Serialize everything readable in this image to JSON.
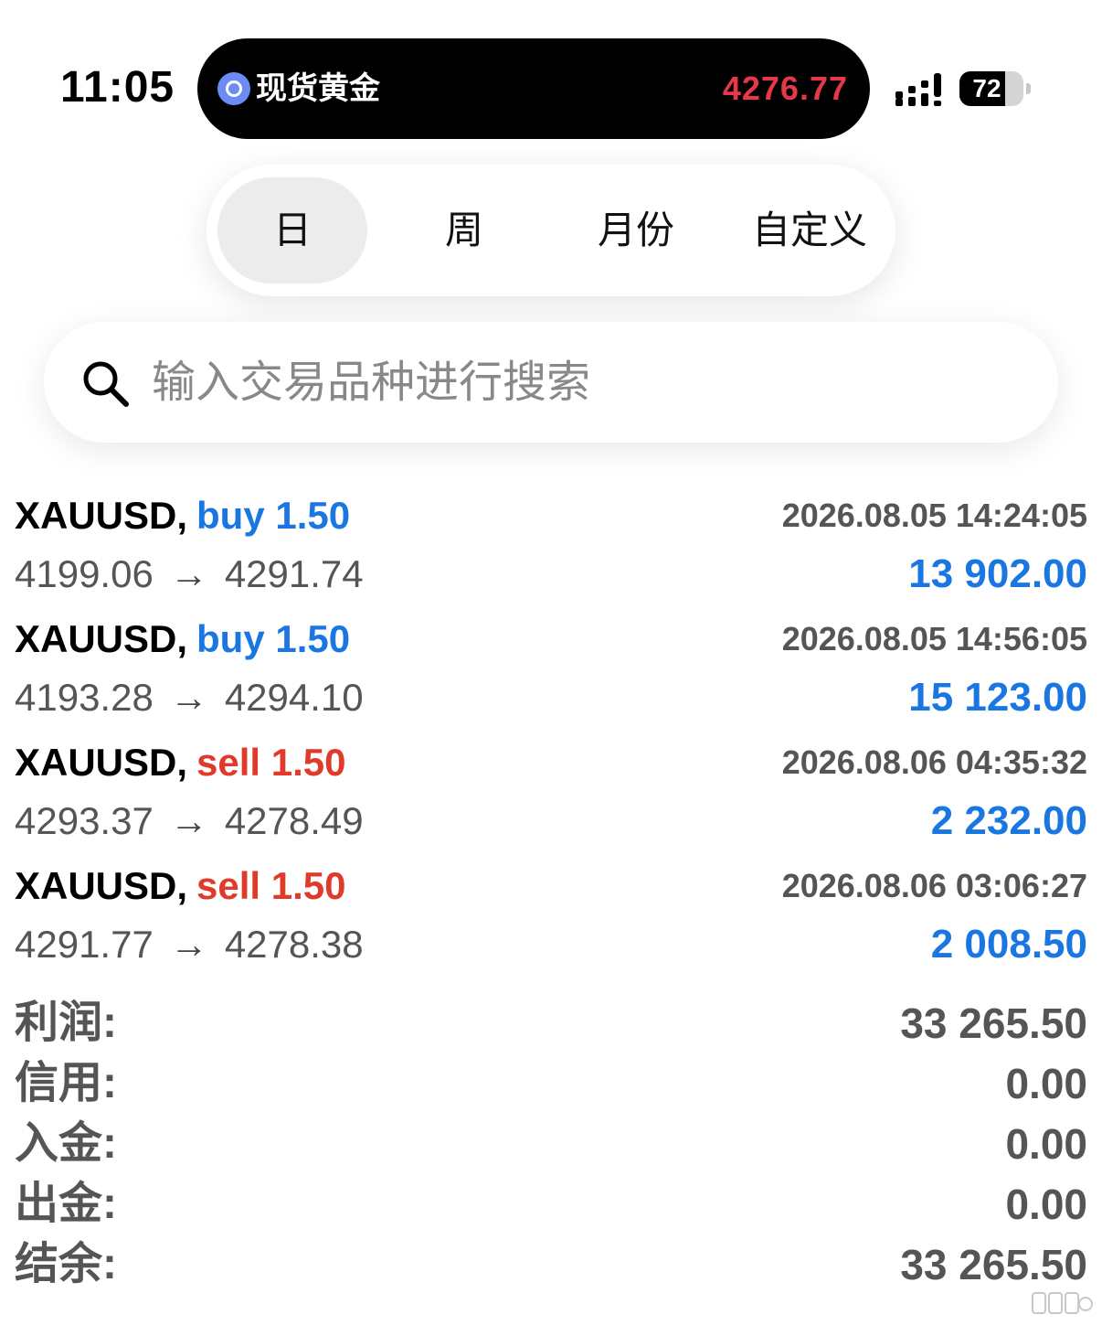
{
  "status_bar": {
    "time": "11:05",
    "island_label": "现货黄金",
    "island_price": "4276.77",
    "battery_text": "72",
    "battery_level": 0.72,
    "price_color": "#e5394a"
  },
  "period_tabs": {
    "selected": 0,
    "items": [
      {
        "label": "日"
      },
      {
        "label": "周"
      },
      {
        "label": "月份"
      },
      {
        "label": "自定义"
      }
    ]
  },
  "search": {
    "placeholder": "输入交易品种进行搜索",
    "value": ""
  },
  "deals": [
    {
      "symbol": "XAUUSD,",
      "side": "buy",
      "side_text": "buy 1.50",
      "time": "2026.08.05 14:24:05",
      "open": "4199.06",
      "arrow": "→",
      "close": "4291.74",
      "profit": "13 902.00"
    },
    {
      "symbol": "XAUUSD,",
      "side": "buy",
      "side_text": "buy 1.50",
      "time": "2026.08.05 14:56:05",
      "open": "4193.28",
      "arrow": "→",
      "close": "4294.10",
      "profit": "15 123.00"
    },
    {
      "symbol": "XAUUSD,",
      "side": "sell",
      "side_text": "sell 1.50",
      "time": "2026.08.06 04:35:32",
      "open": "4293.37",
      "arrow": "→",
      "close": "4278.49",
      "profit": "2 232.00"
    },
    {
      "symbol": "XAUUSD,",
      "side": "sell",
      "side_text": "sell 1.50",
      "time": "2026.08.06 03:06:27",
      "open": "4291.77",
      "arrow": "→",
      "close": "4278.38",
      "profit": "2 008.50"
    }
  ],
  "summary": [
    {
      "label": "利润:",
      "value": "33 265.50"
    },
    {
      "label": "信用:",
      "value": "0.00"
    },
    {
      "label": "入金:",
      "value": "0.00"
    },
    {
      "label": "出金:",
      "value": "0.00"
    },
    {
      "label": "结余:",
      "value": "33 265.50"
    }
  ],
  "colors": {
    "buy": "#1a76e0",
    "sell": "#e03a2b",
    "profit": "#1a76e0",
    "muted_text": "#555555"
  },
  "icons": {
    "app_icon": "gold-quote-app-icon",
    "signal": "cellular-signal-icon",
    "battery": "battery-icon",
    "search": "search-icon",
    "watermark": "weibo-watermark-icon"
  }
}
